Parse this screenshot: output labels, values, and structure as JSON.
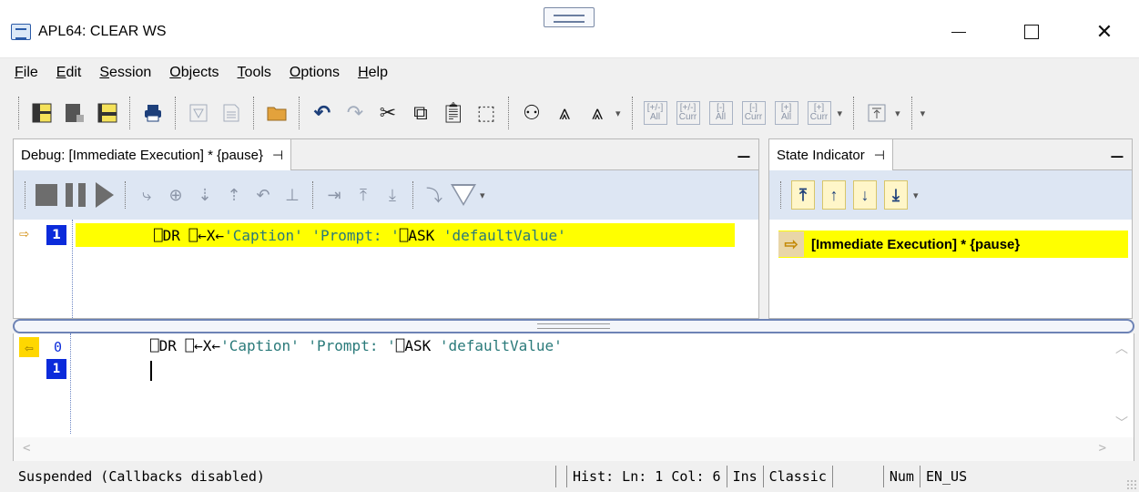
{
  "window": {
    "title": "APL64: CLEAR WS",
    "icon": "apl-workspace-icon",
    "controls": {
      "minimize": "minimize",
      "maximize": "maximize",
      "close": "close"
    }
  },
  "menu": {
    "items": [
      {
        "label": "File",
        "accel": "F"
      },
      {
        "label": "Edit",
        "accel": "E"
      },
      {
        "label": "Session",
        "accel": "S"
      },
      {
        "label": "Objects",
        "accel": "O"
      },
      {
        "label": "Tools",
        "accel": "T"
      },
      {
        "label": "Options",
        "accel": "O"
      },
      {
        "label": "Help",
        "accel": "H"
      }
    ]
  },
  "toolbar": {
    "icons": [
      "layout-left-icon",
      "layout-bottom-icon",
      "layout-right-icon",
      "print-icon",
      "new-function-icon",
      "new-document-icon",
      "open-folder-icon",
      "undo-icon",
      "redo-icon",
      "cut-icon",
      "copy-icon",
      "paste-icon",
      "select-icon",
      "find-icon",
      "find-previous-icon",
      "find-next-icon",
      "fold-all-icon",
      "fold-current-icon",
      "collapse-all-icon",
      "collapse-current-icon",
      "expand-all-icon",
      "expand-current-icon",
      "top-icon"
    ],
    "small_labels": {
      "fold_all": "[+/-]\nAll",
      "fold_curr": "[+/-]\nCurr",
      "collapse_all": "[-]\nAll",
      "collapse_curr": "[-]\nCurr",
      "expand_all": "[+]\nAll",
      "expand_curr": "[+]\nCurr"
    }
  },
  "debug_pane": {
    "tab_label": "Debug: [Immediate Execution] * {pause}",
    "line_number": "1",
    "code_prefix": "⎕DR ⎕←X←",
    "code_str1": "'Caption' 'Prompt: '",
    "code_mid": "⎕ASK ",
    "code_str2": "'defaultValue'"
  },
  "state_pane": {
    "tab_label": "State Indicator",
    "entry": "[Immediate Execution] * {pause}"
  },
  "session": {
    "line0_number": "0",
    "line1_number": "1",
    "line0_prefix": "⎕DR ⎕←X←",
    "line0_str1": "'Caption' 'Prompt: '",
    "line0_mid": "⎕ASK ",
    "line0_str2": "'defaultValue'"
  },
  "status": {
    "message": "Suspended (Callbacks disabled)",
    "hist": "Hist: Ln: 1 Col: 6",
    "mode": "Ins",
    "keyboard": "Classic",
    "num": "Num",
    "locale": "EN_US"
  },
  "colors": {
    "highlight": "#ffff00",
    "line_badge": "#0b2bdb",
    "string": "#2a7a7a",
    "toolbar_blue": "#1d3f7a",
    "pane_toolbar_bg": "#dde6f3"
  }
}
